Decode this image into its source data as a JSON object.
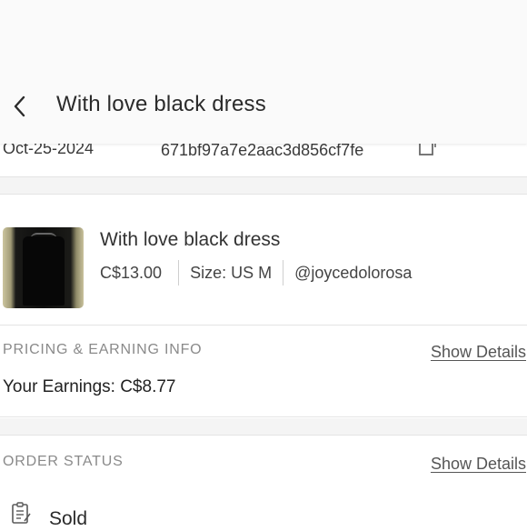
{
  "header": {
    "title": "With love black dress"
  },
  "order": {
    "date": "Oct-25-2024",
    "id": "671bf97a7e2aac3d856cf7fe"
  },
  "product": {
    "title": "With love black dress",
    "price": "C$13.00",
    "size": "Size: US M",
    "seller": "@joycedolorosa"
  },
  "pricing": {
    "heading": "PRICING & EARNING INFO",
    "show_details": "Show Details",
    "earnings": "Your Earnings: C$8.77"
  },
  "status": {
    "heading": "ORDER STATUS",
    "show_details": "Show Details",
    "value": "Sold",
    "icon": "checklist-icon"
  },
  "icons": {
    "back": "chevron-left-icon",
    "copy": "copy-icon"
  }
}
